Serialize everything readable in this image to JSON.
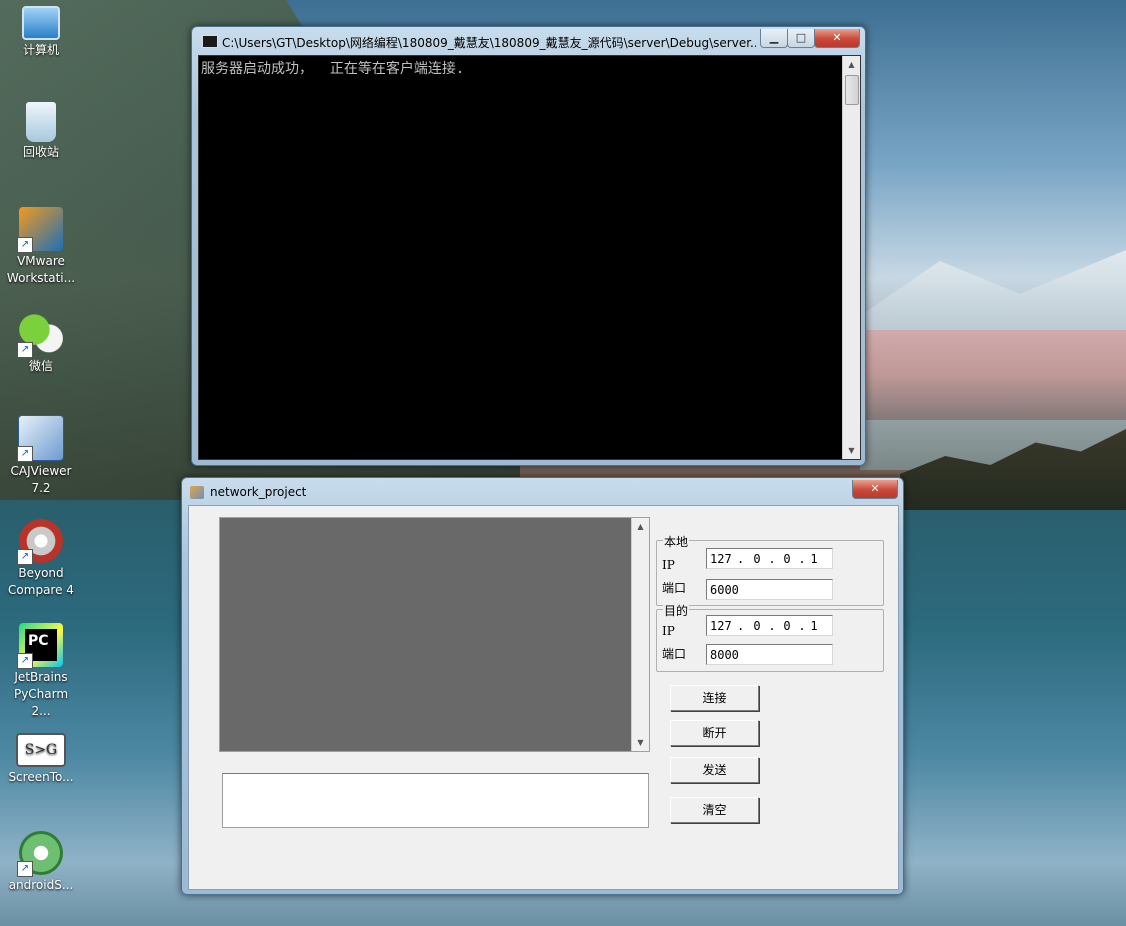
{
  "desktop": {
    "icons": [
      {
        "label": "计算机",
        "icon": "computer-icon"
      },
      {
        "label": "回收站",
        "icon": "recycle-bin-icon"
      },
      {
        "label": "VMware Workstati...",
        "icon": "vmware-icon"
      },
      {
        "label": "微信",
        "icon": "wechat-icon"
      },
      {
        "label": "CAJViewer 7.2",
        "icon": "cajviewer-icon"
      },
      {
        "label": "Beyond Compare 4",
        "icon": "beyond-compare-icon"
      },
      {
        "label": "JetBrains PyCharm 2...",
        "icon": "pycharm-icon"
      },
      {
        "label": "ScreenTo...",
        "icon": "screentogif-icon"
      },
      {
        "label": "androidS...",
        "icon": "android-studio-icon"
      }
    ]
  },
  "console": {
    "title": "C:\\Users\\GT\\Desktop\\网络编程\\180809_戴慧友\\180809_戴慧友_源代码\\server\\Debug\\server....",
    "output": "服务器启动成功，  正在等在客户端连接.",
    "controls": {
      "minimize": "▁",
      "maximize": "□",
      "close": "✕"
    }
  },
  "dialog": {
    "title": "network_project",
    "close": "✕",
    "local": {
      "group_label": "本地",
      "ip_label": "IP",
      "ip": [
        "127",
        "0",
        "0",
        "1"
      ],
      "port_label": "端口",
      "port": "6000"
    },
    "remote": {
      "group_label": "目的",
      "ip_label": "IP",
      "ip": [
        "127",
        "0",
        "0",
        "1"
      ],
      "port_label": "端口",
      "port": "8000"
    },
    "buttons": {
      "connect": "连接",
      "disconnect": "断开",
      "send": "发送",
      "clear": "清空"
    },
    "send_text": ""
  },
  "colors": {
    "console_bg": "#000000",
    "console_text": "#c0c0c0",
    "receive_box": "#696969",
    "dialog_bg": "#f0f0f0"
  }
}
